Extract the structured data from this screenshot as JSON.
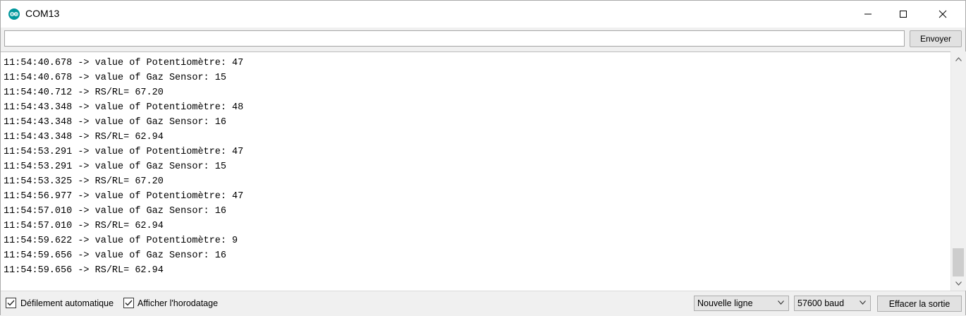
{
  "window": {
    "title": "COM13",
    "accent_color": "#00979c"
  },
  "send": {
    "input_value": "",
    "button_label": "Envoyer"
  },
  "log": [
    "11:54:40.678 -> value of Potentiomètre: 47",
    "11:54:40.678 -> value of Gaz Sensor: 15",
    "11:54:40.712 -> RS/RL= 67.20",
    "11:54:43.348 -> value of Potentiomètre: 48",
    "11:54:43.348 -> value of Gaz Sensor: 16",
    "11:54:43.348 -> RS/RL= 62.94",
    "11:54:53.291 -> value of Potentiomètre: 47",
    "11:54:53.291 -> value of Gaz Sensor: 15",
    "11:54:53.325 -> RS/RL= 67.20",
    "11:54:56.977 -> value of Potentiomètre: 47",
    "11:54:57.010 -> value of Gaz Sensor: 16",
    "11:54:57.010 -> RS/RL= 62.94",
    "11:54:59.622 -> value of Potentiomètre: 9",
    "11:54:59.656 -> value of Gaz Sensor: 16",
    "11:54:59.656 -> RS/RL= 62.94"
  ],
  "footer": {
    "autoscroll_label": "Défilement automatique",
    "autoscroll_checked": true,
    "timestamp_label": "Afficher l'horodatage",
    "timestamp_checked": true,
    "line_ending": "Nouvelle ligne",
    "baud_rate": "57600 baud",
    "clear_label": "Effacer la sortie"
  }
}
